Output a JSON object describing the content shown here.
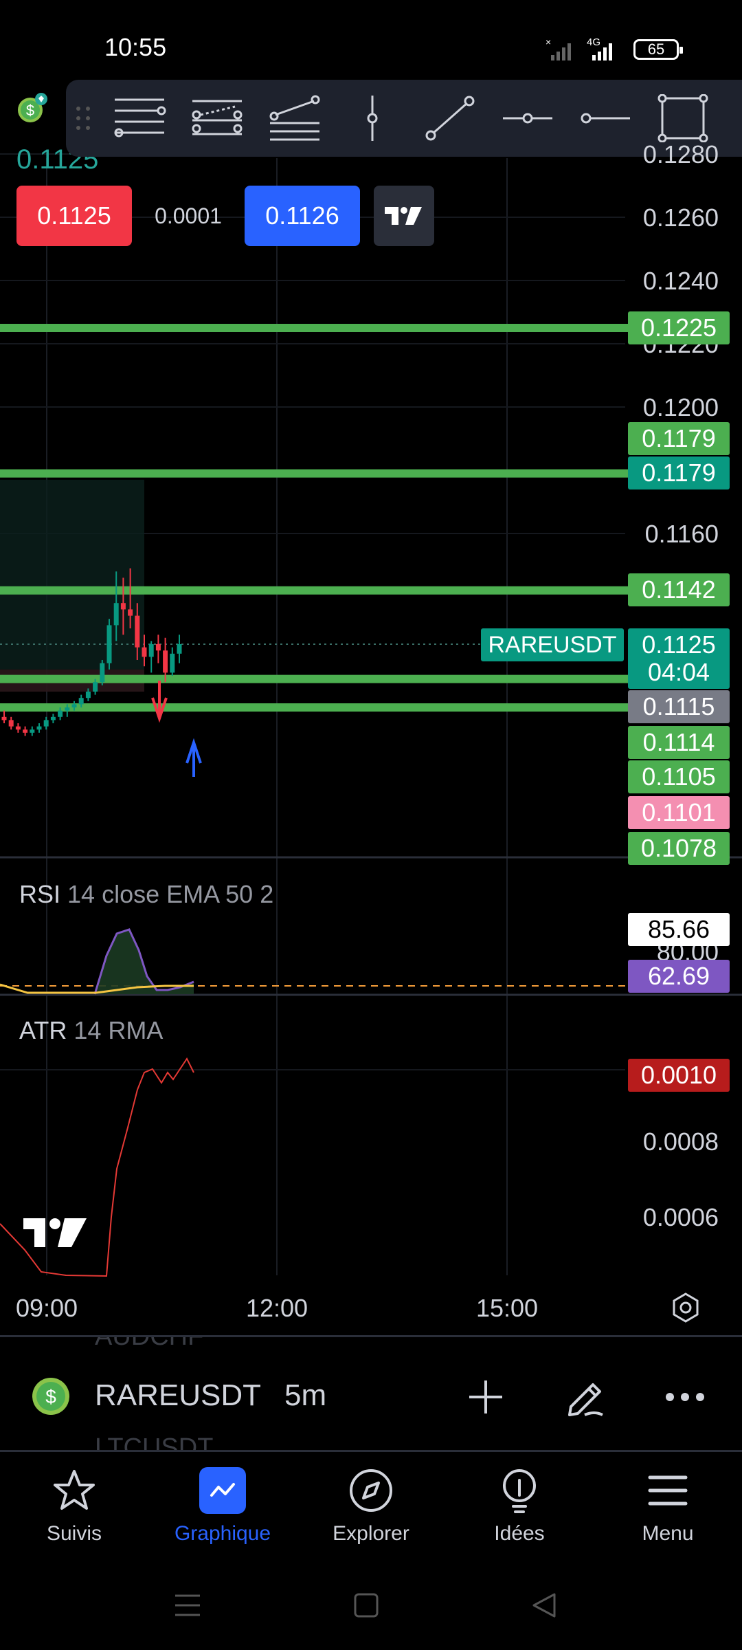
{
  "status": {
    "time": "10:55",
    "network": "4G",
    "battery": "65"
  },
  "chart_cut_price": "0.1125",
  "trade": {
    "sell_price": "0.1125",
    "spread": "0.0001",
    "buy_price": "0.1126"
  },
  "price_axis": {
    "labels": [
      {
        "text": "0.1260",
        "value": 0.126
      },
      {
        "text": "0.1240",
        "value": 0.124
      },
      {
        "text": "0.1200",
        "value": 0.12
      },
      {
        "text": "0.1160",
        "value": 0.116
      }
    ],
    "partial_labels": [
      {
        "text": "0.1280",
        "value": 0.128
      },
      {
        "text": "0.1220",
        "value": 0.122
      }
    ]
  },
  "levels": [
    {
      "text": "0.1225",
      "value": 0.1225,
      "color": "#4caf50"
    },
    {
      "text": "0.1179",
      "value": 0.1179,
      "color": "#4caf50"
    },
    {
      "text": "0.1142",
      "value": 0.1142,
      "color": "#4caf50"
    },
    {
      "text": "0.1114",
      "value": 0.1114,
      "color": "#4caf50"
    },
    {
      "text": "0.1105",
      "value": 0.1105,
      "color": "#4caf50"
    }
  ],
  "badges": [
    {
      "text": "0.1179",
      "value": 0.1179,
      "color": "#4caf50"
    },
    {
      "text": "0.1179",
      "value": 0.1179,
      "color": "#089981"
    },
    {
      "text": "0.1142",
      "value": 0.1142,
      "color": "#4caf50"
    },
    {
      "text": "0.1115",
      "value": 0.1115,
      "color": "#787b86"
    },
    {
      "text": "0.1114",
      "value": 0.1114,
      "color": "#4caf50"
    },
    {
      "text": "0.1105",
      "value": 0.1105,
      "color": "#4caf50"
    },
    {
      "text": "0.1101",
      "value": 0.1101,
      "color": "#f48fb1"
    },
    {
      "text": "0.1078",
      "value": 0.1078,
      "color": "#4caf50"
    }
  ],
  "top_badge": {
    "text": "0.1225",
    "value": 0.1225,
    "color": "#4caf50"
  },
  "current": {
    "symbol": "RAREUSDT",
    "price": "0.1125",
    "value": 0.1125,
    "countdown": "04:04",
    "color": "#089981"
  },
  "rsi": {
    "name": "RSI",
    "params": "14 close EMA 50 2",
    "value": "85.66",
    "value2": "62.69",
    "partial_label": "80.00",
    "value2_color": "#7e57c2"
  },
  "atr": {
    "name": "ATR",
    "params": "14 RMA",
    "value": "0.0010",
    "value_color": "#b71c1c",
    "labels": [
      "0.0008",
      "0.0006"
    ]
  },
  "time_axis": [
    "09:00",
    "12:00",
    "15:00"
  ],
  "chart_data": {
    "type": "candlestick",
    "symbol": "RAREUSDT",
    "interval": "5m",
    "x": [
      "09:00",
      "12:00",
      "15:00"
    ],
    "y_range": [
      0.1078,
      0.128
    ],
    "horizontal_levels": [
      0.1225,
      0.1179,
      0.1142,
      0.1114,
      0.1105
    ],
    "last_price": 0.1125,
    "candles": [
      {
        "o": 0.1102,
        "h": 0.1104,
        "l": 0.11,
        "c": 0.1101
      },
      {
        "o": 0.1101,
        "h": 0.1102,
        "l": 0.1098,
        "c": 0.1099
      },
      {
        "o": 0.1099,
        "h": 0.11,
        "l": 0.1097,
        "c": 0.1098
      },
      {
        "o": 0.1098,
        "h": 0.1099,
        "l": 0.1096,
        "c": 0.1097
      },
      {
        "o": 0.1097,
        "h": 0.1099,
        "l": 0.1096,
        "c": 0.1098
      },
      {
        "o": 0.1098,
        "h": 0.11,
        "l": 0.1097,
        "c": 0.1099
      },
      {
        "o": 0.1099,
        "h": 0.1102,
        "l": 0.1098,
        "c": 0.1101
      },
      {
        "o": 0.1101,
        "h": 0.1103,
        "l": 0.11,
        "c": 0.1102
      },
      {
        "o": 0.1102,
        "h": 0.1105,
        "l": 0.1101,
        "c": 0.1104
      },
      {
        "o": 0.1104,
        "h": 0.1106,
        "l": 0.1102,
        "c": 0.1105
      },
      {
        "o": 0.1105,
        "h": 0.1107,
        "l": 0.1104,
        "c": 0.1106
      },
      {
        "o": 0.1106,
        "h": 0.1109,
        "l": 0.1105,
        "c": 0.1108
      },
      {
        "o": 0.1108,
        "h": 0.1111,
        "l": 0.1107,
        "c": 0.111
      },
      {
        "o": 0.111,
        "h": 0.1114,
        "l": 0.1109,
        "c": 0.1113
      },
      {
        "o": 0.1113,
        "h": 0.112,
        "l": 0.1112,
        "c": 0.1119
      },
      {
        "o": 0.1119,
        "h": 0.1133,
        "l": 0.1117,
        "c": 0.1131
      },
      {
        "o": 0.1131,
        "h": 0.1148,
        "l": 0.1126,
        "c": 0.1138
      },
      {
        "o": 0.1138,
        "h": 0.1146,
        "l": 0.1128,
        "c": 0.1136
      },
      {
        "o": 0.1136,
        "h": 0.1149,
        "l": 0.113,
        "c": 0.1134
      },
      {
        "o": 0.1134,
        "h": 0.1138,
        "l": 0.112,
        "c": 0.1124
      },
      {
        "o": 0.1124,
        "h": 0.1128,
        "l": 0.1118,
        "c": 0.1121
      },
      {
        "o": 0.1121,
        "h": 0.1126,
        "l": 0.1116,
        "c": 0.1125
      },
      {
        "o": 0.1125,
        "h": 0.1128,
        "l": 0.1119,
        "c": 0.1123
      },
      {
        "o": 0.1123,
        "h": 0.1127,
        "l": 0.1113,
        "c": 0.1116
      },
      {
        "o": 0.1116,
        "h": 0.1124,
        "l": 0.1115,
        "c": 0.1122
      },
      {
        "o": 0.1122,
        "h": 0.1128,
        "l": 0.1119,
        "c": 0.1125
      }
    ]
  },
  "symbol_bar": {
    "prev_symbol": "AUDCHF",
    "symbol": "RAREUSDT",
    "interval": "5m",
    "next_symbol": "LTCUSDT"
  },
  "nav": [
    {
      "label": "Suivis",
      "icon": "star-icon"
    },
    {
      "label": "Graphique",
      "icon": "chart-icon",
      "active": true
    },
    {
      "label": "Explorer",
      "icon": "compass-icon"
    },
    {
      "label": "Idées",
      "icon": "lightbulb-icon"
    },
    {
      "label": "Menu",
      "icon": "menu-icon"
    }
  ]
}
